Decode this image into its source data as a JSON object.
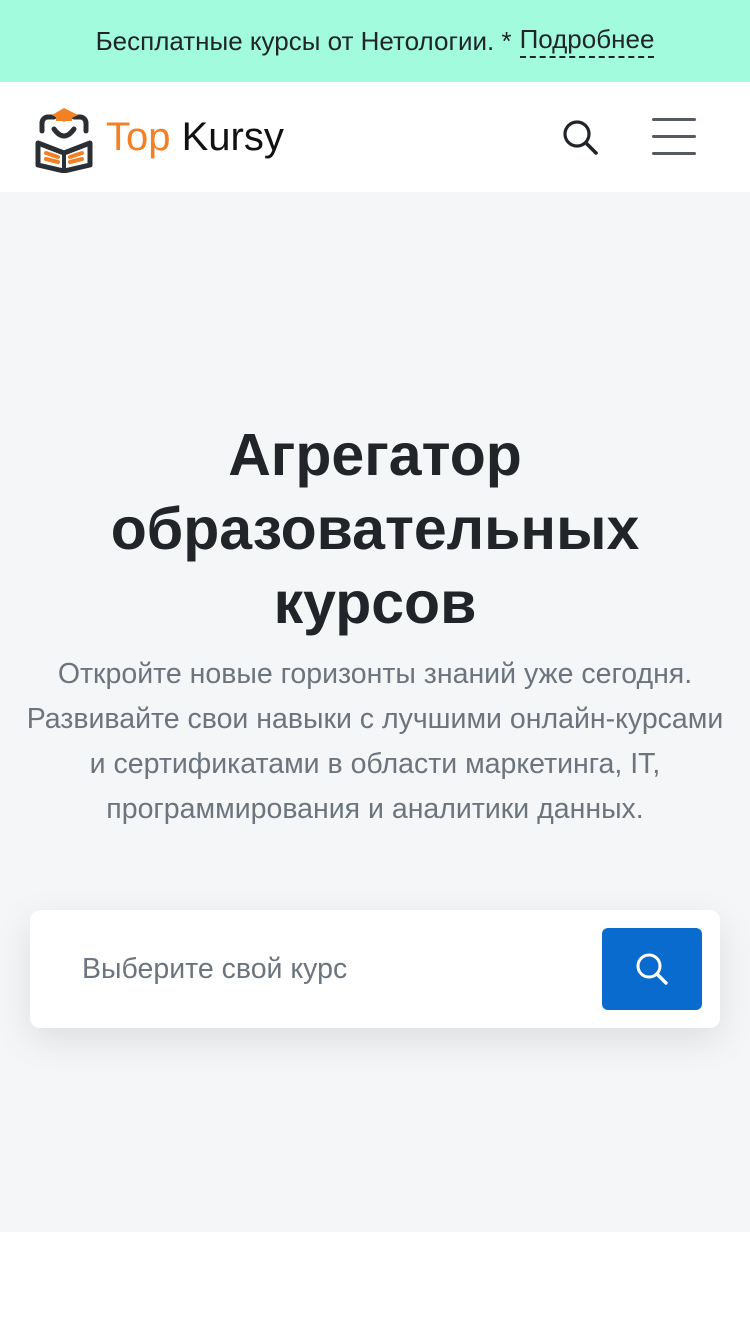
{
  "promo": {
    "text": "Бесплатные курсы от Нетологии. *",
    "link_label": "Подробнее"
  },
  "header": {
    "logo": {
      "icon": "graduate-book-icon",
      "word1": "Top",
      "word2": "Kursy"
    },
    "search_icon": "search-icon",
    "menu_icon": "hamburger-menu-icon"
  },
  "hero": {
    "title": "Агрегатор образовательных курсов",
    "subtitle": "Откройте новые горизонты знаний уже сегодня. Развивайте свои навыки с лучшими онлайн-курсами и сертификатами в области маркетинга, IT, программирования и аналитики данных.",
    "search": {
      "placeholder": "Выберите свой курс",
      "value": "",
      "button_icon": "search-icon"
    }
  },
  "colors": {
    "promo_bg": "#a1fbdc",
    "accent_orange": "#f48024",
    "button_blue": "#0a6bce",
    "hero_bg": "#f4f6f8",
    "text_dark": "#212529",
    "text_muted": "#6c757d"
  }
}
